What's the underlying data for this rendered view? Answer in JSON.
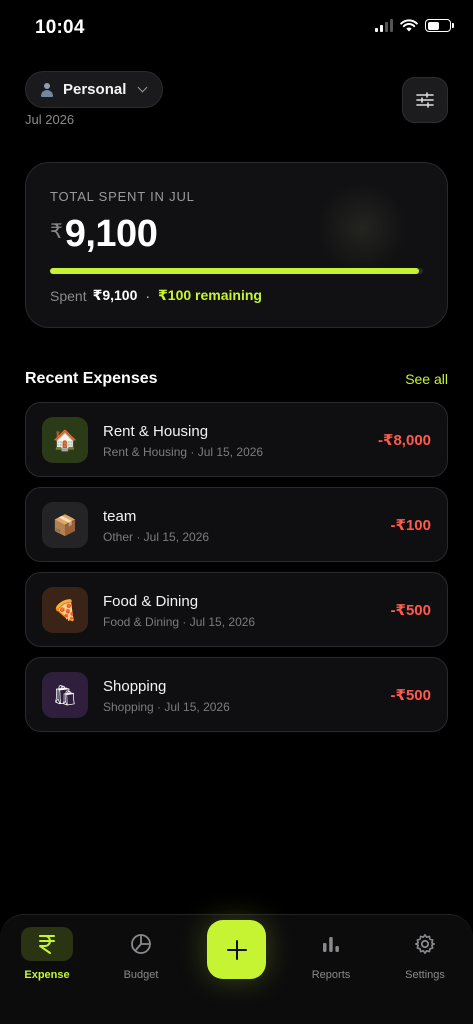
{
  "status_bar": {
    "time": "10:04"
  },
  "header": {
    "profile_label": "Personal",
    "date": "Jul 2026"
  },
  "summary": {
    "label": "TOTAL SPENT IN JUL",
    "currency": "₹",
    "amount": "9,100",
    "spent_label": "Spent",
    "spent_value": "₹9,100",
    "separator": "·",
    "remaining": "₹100 remaining",
    "progress_fraction": 0.989,
    "accent_color": "#c6f432"
  },
  "recent": {
    "title": "Recent Expenses",
    "see_all": "See all",
    "items": [
      {
        "title": "Rent & Housing",
        "subtitle": "Rent & Housing · Jul 15, 2026",
        "amount": "-₹8,000",
        "icon": "house-icon",
        "icon_glyph": "🏠",
        "icon_bg": "#2b3a17"
      },
      {
        "title": "team",
        "subtitle": "Other · Jul 15, 2026",
        "amount": "-₹100",
        "icon": "package-icon",
        "icon_glyph": "📦",
        "icon_bg": "#242426"
      },
      {
        "title": "Food & Dining",
        "subtitle": "Food & Dining · Jul 15, 2026",
        "amount": "-₹500",
        "icon": "pizza-icon",
        "icon_glyph": "🍕",
        "icon_bg": "#3a2418"
      },
      {
        "title": "Shopping",
        "subtitle": "Shopping · Jul 15, 2026",
        "amount": "-₹500",
        "icon": "shopping-bag-icon",
        "icon_glyph": "🛍",
        "icon_bg": "#2f1f3d"
      }
    ]
  },
  "nav": {
    "items": [
      {
        "label": "Expense",
        "icon": "rupee-icon",
        "active": true
      },
      {
        "label": "Budget",
        "icon": "pie-chart-icon",
        "active": false
      },
      {
        "label": "Reports",
        "icon": "bar-chart-icon",
        "active": false
      },
      {
        "label": "Settings",
        "icon": "gear-icon",
        "active": false
      }
    ],
    "add_icon": "plus-icon"
  },
  "colors": {
    "accent": "#c6f432",
    "negative": "#ff5a4e",
    "background": "#000000"
  }
}
